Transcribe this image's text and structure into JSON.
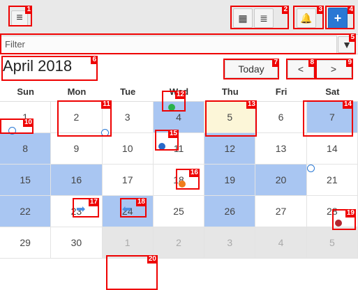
{
  "toolbar": {
    "menu_icon": "hamburger-menu-icon",
    "calendar_view_icon": "calendar-view-icon",
    "list_view_icon": "list-view-icon",
    "alarm_icon": "alarm-bell-icon",
    "add_icon": "plus-icon"
  },
  "filter": {
    "placeholder": "Filter",
    "value": "Filter",
    "filter_icon": "funnel-icon"
  },
  "calendar": {
    "month_title": "April 2018",
    "today_label": "Today",
    "prev_label": "<",
    "next_label": ">",
    "weekdays": [
      "Sun",
      "Mon",
      "Tue",
      "Wed",
      "Thu",
      "Fri",
      "Sat"
    ],
    "weeks": [
      [
        "1",
        "2",
        "3",
        "4",
        "5",
        "6",
        "7"
      ],
      [
        "8",
        "9",
        "10",
        "11",
        "12",
        "13",
        "14"
      ],
      [
        "15",
        "16",
        "17",
        "18",
        "19",
        "20",
        "21"
      ],
      [
        "22",
        "23",
        "24",
        "25",
        "26",
        "27",
        "28"
      ],
      [
        "29",
        "30",
        "1",
        "2",
        "3",
        "4",
        "5"
      ]
    ],
    "event_colors": {
      "green": "#2ab24a",
      "blue": "#2869c9",
      "orange": "#f07d1a",
      "red": "#b3262e",
      "selected": "#a9c6f2",
      "today": "#fcf6d8"
    }
  },
  "annotations": [
    "1",
    "2",
    "3",
    "4",
    "5",
    "6",
    "7",
    "8",
    "9",
    "10",
    "11",
    "12",
    "13",
    "14",
    "15",
    "16",
    "17",
    "18",
    "19",
    "20"
  ]
}
